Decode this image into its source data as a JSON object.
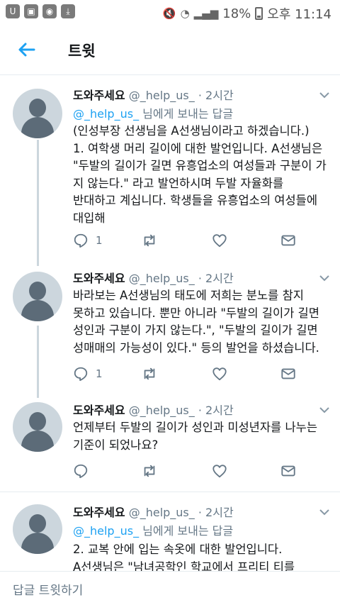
{
  "status_bar": {
    "battery": "18%",
    "time": "오후 11:14",
    "left_icons": [
      "u-icon",
      "image-icon",
      "camera-icon",
      "download-icon"
    ]
  },
  "header": {
    "title": "트윗"
  },
  "tweets": [
    {
      "name": "도와주세요",
      "handle": "@_help_us_",
      "dot": "·",
      "time": "2시간",
      "reply_to_mention": "@_help_us_",
      "reply_to_suffix": " 님에게 보내는 답글",
      "text": "(인성부장 선생님을 A선생님이라고 하겠습니다.)\n1. 여학생 머리 길이에 대한 발언입니다. A선생님은 \"두발의 길이가 길면 유흥업소의 여성들과 구분이 가지 않는다.\" 라고 발언하시며 두발 자율화를\n반대하고 계십니다. 학생들을 유흥업소의 여성들에\n대입해",
      "reply_count": "1"
    },
    {
      "name": "도와주세요",
      "handle": "@_help_us_",
      "dot": "·",
      "time": "2시간",
      "text": "바라보는 A선생님의 태도에 저희는 분노를 참지\n못하고 있습니다. 뿐만 아니라 \"두발의 길이가 길면\n성인과 구분이 가지 않는다.\", \"두발의 길이가 길면\n성매매의 가능성이 있다.\" 등의 발언을 하셨습니다.",
      "reply_count": "1"
    },
    {
      "name": "도와주세요",
      "handle": "@_help_us_",
      "dot": "·",
      "time": "2시간",
      "text": "언제부터 두발의 길이가 성인과 미성년자를 나누는\n기준이 되었나요?",
      "reply_count": ""
    },
    {
      "name": "도와주세요",
      "handle": "@_help_us_",
      "dot": "·",
      "time": "2시간",
      "reply_to_mention": "@_help_us_",
      "reply_to_suffix": " 님에게 보내는 답글",
      "text": "2. 교복 안에 입는 속옷에 대한 발언입니다.\nA선생님은 \"남녀공학인 학교에서 프리티 티를"
    }
  ],
  "bottom_bar": {
    "placeholder": "답글 트윗하기"
  },
  "colors": {
    "accent": "#1da1f2",
    "secondary": "#657786",
    "divider": "#e6ecf0"
  }
}
